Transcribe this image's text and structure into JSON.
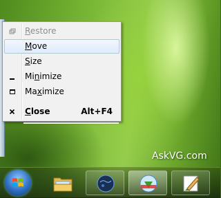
{
  "system_menu": {
    "items": [
      {
        "label": "Restore",
        "mnemonic": "R",
        "rest": "estore",
        "icon": "restore-icon",
        "enabled": false
      },
      {
        "label": "Move",
        "mnemonic": "M",
        "rest": "ove",
        "icon": "",
        "enabled": true,
        "highlighted": true
      },
      {
        "label": "Size",
        "mnemonic": "S",
        "rest": "ize",
        "icon": "",
        "enabled": true
      },
      {
        "label": "Minimize",
        "pre": "Mi",
        "mnemonic": "n",
        "rest": "imize",
        "icon": "minimize-icon",
        "enabled": true
      },
      {
        "label": "Maximize",
        "pre": "Ma",
        "mnemonic": "x",
        "rest": "imize",
        "icon": "maximize-icon",
        "enabled": true
      },
      {
        "label": "Close",
        "mnemonic": "C",
        "rest": "lose",
        "icon": "close-icon",
        "enabled": true,
        "shortcut": "Alt+F4"
      }
    ]
  },
  "watermark": "AskVG.com",
  "taskbar": {
    "start_button": "start-button",
    "apps": [
      {
        "icon": "windows-explorer-icon"
      },
      {
        "icon": "globe-icon"
      },
      {
        "icon": "download-manager-icon"
      },
      {
        "icon": "paint-icon"
      }
    ]
  },
  "colors": {
    "menu_bg": "#f1f1f1",
    "hover_border": "#a8c8ec",
    "desktop_green": "#77b634"
  }
}
